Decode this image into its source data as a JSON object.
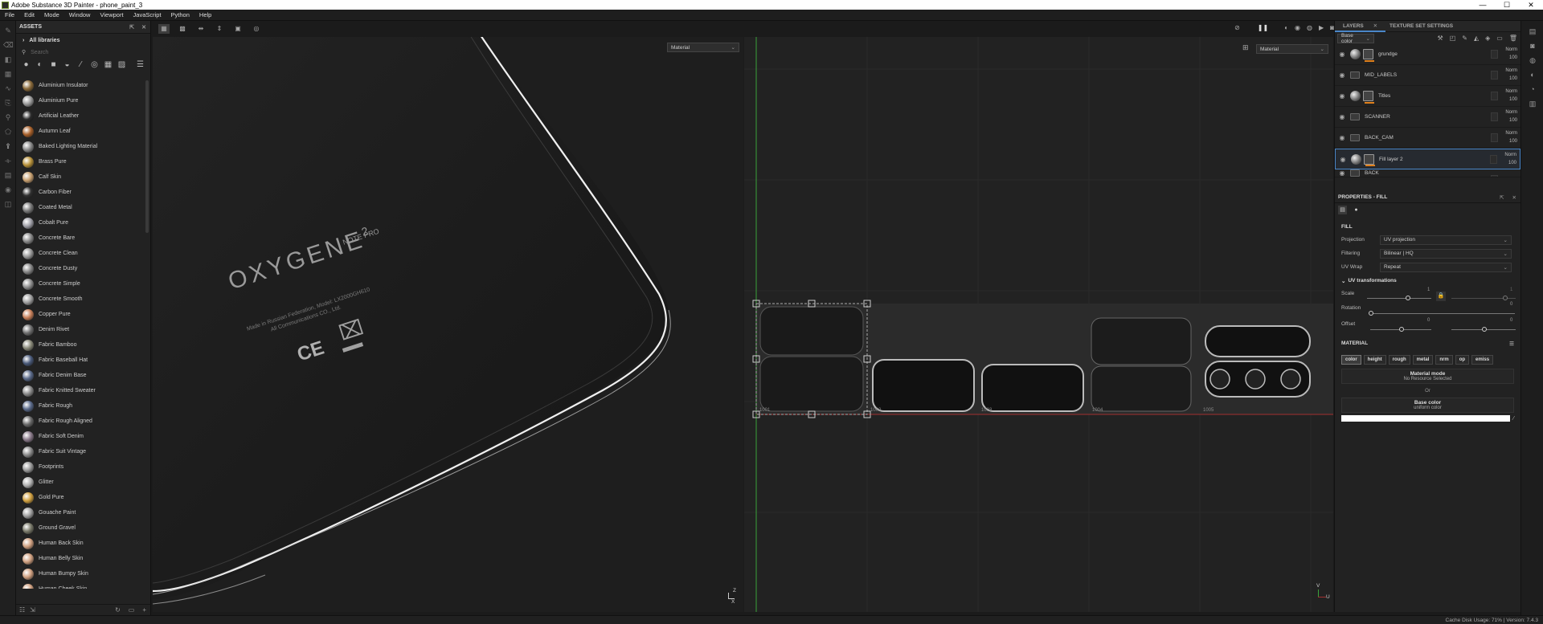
{
  "window": {
    "title": "Adobe Substance 3D Painter - phone_paint_3",
    "minimize": "—",
    "maximize": "☐",
    "close": "✕"
  },
  "menu": [
    "File",
    "Edit",
    "Mode",
    "Window",
    "Viewport",
    "JavaScript",
    "Python",
    "Help"
  ],
  "assets": {
    "title": "ASSETS",
    "library": "All libraries",
    "search_placeholder": "Search",
    "items": [
      {
        "name": "Aluminium Insulator",
        "color": "#8a6a3a"
      },
      {
        "name": "Aluminium Pure",
        "color": "#9a9a9a"
      },
      {
        "name": "Artificial Leather",
        "color": "#2a2a2a"
      },
      {
        "name": "Autumn Leaf",
        "color": "#a8602a"
      },
      {
        "name": "Baked Lighting Material",
        "color": "#8a8a8a"
      },
      {
        "name": "Brass Pure",
        "color": "#b8923a"
      },
      {
        "name": "Calf Skin",
        "color": "#c8a070"
      },
      {
        "name": "Carbon Fiber",
        "color": "#303030"
      },
      {
        "name": "Coated Metal",
        "color": "#7a7a7a"
      },
      {
        "name": "Cobalt Pure",
        "color": "#a0a0a8"
      },
      {
        "name": "Concrete Bare",
        "color": "#8a8a8a"
      },
      {
        "name": "Concrete Clean",
        "color": "#9a9a9a"
      },
      {
        "name": "Concrete Dusty",
        "color": "#888888"
      },
      {
        "name": "Concrete Simple",
        "color": "#909090"
      },
      {
        "name": "Concrete Smooth",
        "color": "#a0a0a0"
      },
      {
        "name": "Copper Pure",
        "color": "#c8805a"
      },
      {
        "name": "Denim Rivet",
        "color": "#707070"
      },
      {
        "name": "Fabric Bamboo",
        "color": "#8a8a7a"
      },
      {
        "name": "Fabric Baseball Hat",
        "color": "#4a5a7a"
      },
      {
        "name": "Fabric Denim Base",
        "color": "#5a6a8a"
      },
      {
        "name": "Fabric Knitted Sweater",
        "color": "#8a8a8a"
      },
      {
        "name": "Fabric Rough",
        "color": "#5a6a8a"
      },
      {
        "name": "Fabric Rough Aligned",
        "color": "#6a6a6a"
      },
      {
        "name": "Fabric Soft Denim",
        "color": "#8a7a8a"
      },
      {
        "name": "Fabric Suit Vintage",
        "color": "#8a8a8a"
      },
      {
        "name": "Footprints",
        "color": "#9a9a9a"
      },
      {
        "name": "Glitter",
        "color": "#b0b0b0"
      },
      {
        "name": "Gold Pure",
        "color": "#d0a040"
      },
      {
        "name": "Gouache Paint",
        "color": "#a0a0a0"
      },
      {
        "name": "Ground Gravel",
        "color": "#7a7a6a"
      },
      {
        "name": "Human Back Skin",
        "color": "#d0a080"
      },
      {
        "name": "Human Belly Skin",
        "color": "#d0a080"
      },
      {
        "name": "Human Bumpy Skin",
        "color": "#d0a080"
      },
      {
        "name": "Human Cheek Skin",
        "color": "#d0a080"
      }
    ]
  },
  "viewport3d": {
    "channel": "Material",
    "brand": "OXYGENE",
    "superscript": "2",
    "model": "NOTE PRO",
    "legal_1": "Made in Russian Federation, Model: LX2000GH610",
    "legal_2": "All Communications CO., Ltd.",
    "ce_mark": "CE",
    "axis_z": "Z",
    "axis_x": "X"
  },
  "viewport2d": {
    "channel": "Material",
    "udims": [
      "1001",
      "1002",
      "1003",
      "1004",
      "1005"
    ],
    "axis_v": "V",
    "axis_u": "U"
  },
  "layers": {
    "tab_layers": "LAYERS",
    "tab_texture": "TEXTURE SET SETTINGS",
    "channel": "Base color",
    "items": [
      {
        "name": "grundge",
        "blend": "Norm",
        "opacity": "100",
        "type": "fill",
        "mask": true
      },
      {
        "name": "MID_LABELS",
        "blend": "Norm",
        "opacity": "100",
        "type": "folder",
        "mask": false
      },
      {
        "name": "Titles",
        "blend": "Norm",
        "opacity": "100",
        "type": "fill",
        "mask": true
      },
      {
        "name": "SCANNER",
        "blend": "Norm",
        "opacity": "100",
        "type": "folder",
        "mask": false
      },
      {
        "name": "BACK_CAM",
        "blend": "Norm",
        "opacity": "100",
        "type": "folder",
        "mask": false
      },
      {
        "name": "Fill layer 2",
        "blend": "Norm",
        "opacity": "100",
        "type": "fill",
        "mask": true,
        "selected": true
      },
      {
        "name": "BACK",
        "blend": "",
        "opacity": "",
        "type": "folder",
        "mask": false
      }
    ]
  },
  "properties": {
    "title": "PROPERTIES - FILL",
    "fill_section": "FILL",
    "projection_label": "Projection",
    "projection": "UV projection",
    "filtering_label": "Filtering",
    "filtering": "Bilinear | HQ",
    "uvwrap_label": "UV Wrap",
    "uvwrap": "Repeat",
    "uv_transforms": "UV transformations",
    "scale_label": "Scale",
    "scale_value": "1",
    "scale_value_2": "1",
    "rotation_label": "Rotation",
    "rotation_value": "0",
    "offset_label": "Offset",
    "offset_value_1": "0",
    "offset_value_2": "0",
    "material_section": "MATERIAL",
    "channels": [
      "color",
      "height",
      "rough",
      "metal",
      "nrm",
      "op",
      "emiss"
    ],
    "material_mode_title": "Material mode",
    "material_mode_value": "No Resource Selected",
    "or": "Or",
    "base_color_title": "Base color",
    "base_color_sub": "uniform color",
    "base_color_swatch": "#ffffff"
  },
  "status": {
    "text": "Cache Disk Usage:  71% | Version: 7.4.3"
  }
}
